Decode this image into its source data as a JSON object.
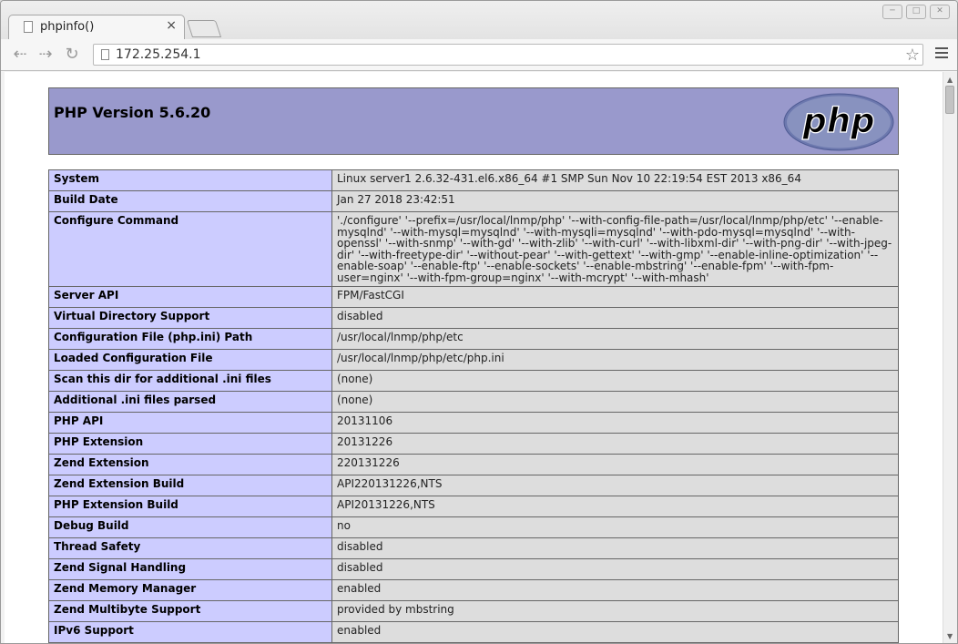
{
  "browser": {
    "tab_title": "phpinfo()",
    "tab_close": "×",
    "url": "172.25.254.1"
  },
  "header": {
    "title": "PHP Version 5.6.20",
    "logo_text": "php"
  },
  "table": {
    "rows": [
      {
        "label": "System",
        "value": "Linux server1 2.6.32-431.el6.x86_64 #1 SMP Sun Nov 10 22:19:54 EST 2013 x86_64"
      },
      {
        "label": "Build Date",
        "value": "Jan 27 2018 23:42:51"
      },
      {
        "label": "Configure Command",
        "value": "'./configure' '--prefix=/usr/local/lnmp/php' '--with-config-file-path=/usr/local/lnmp/php/etc' '--enable-mysqlnd' '--with-mysql=mysqlnd' '--with-mysqli=mysqlnd' '--with-pdo-mysql=mysqlnd' '--with-openssl' '--with-snmp' '--with-gd' '--with-zlib' '--with-curl' '--with-libxml-dir' '--with-png-dir' '--with-jpeg-dir' '--with-freetype-dir' '--without-pear' '--with-gettext' '--with-gmp' '--enable-inline-optimization' '--enable-soap' '--enable-ftp' '--enable-sockets' '--enable-mbstring' '--enable-fpm' '--with-fpm-user=nginx' '--with-fpm-group=nginx' '--with-mcrypt' '--with-mhash'"
      },
      {
        "label": "Server API",
        "value": "FPM/FastCGI"
      },
      {
        "label": "Virtual Directory Support",
        "value": "disabled"
      },
      {
        "label": "Configuration File (php.ini) Path",
        "value": "/usr/local/lnmp/php/etc"
      },
      {
        "label": "Loaded Configuration File",
        "value": "/usr/local/lnmp/php/etc/php.ini"
      },
      {
        "label": "Scan this dir for additional .ini files",
        "value": "(none)"
      },
      {
        "label": "Additional .ini files parsed",
        "value": "(none)"
      },
      {
        "label": "PHP API",
        "value": "20131106"
      },
      {
        "label": "PHP Extension",
        "value": "20131226"
      },
      {
        "label": "Zend Extension",
        "value": "220131226"
      },
      {
        "label": "Zend Extension Build",
        "value": "API220131226,NTS"
      },
      {
        "label": "PHP Extension Build",
        "value": "API20131226,NTS"
      },
      {
        "label": "Debug Build",
        "value": "no"
      },
      {
        "label": "Thread Safety",
        "value": "disabled"
      },
      {
        "label": "Zend Signal Handling",
        "value": "disabled"
      },
      {
        "label": "Zend Memory Manager",
        "value": "enabled"
      },
      {
        "label": "Zend Multibyte Support",
        "value": "provided by mbstring"
      },
      {
        "label": "IPv6 Support",
        "value": "enabled"
      }
    ]
  }
}
